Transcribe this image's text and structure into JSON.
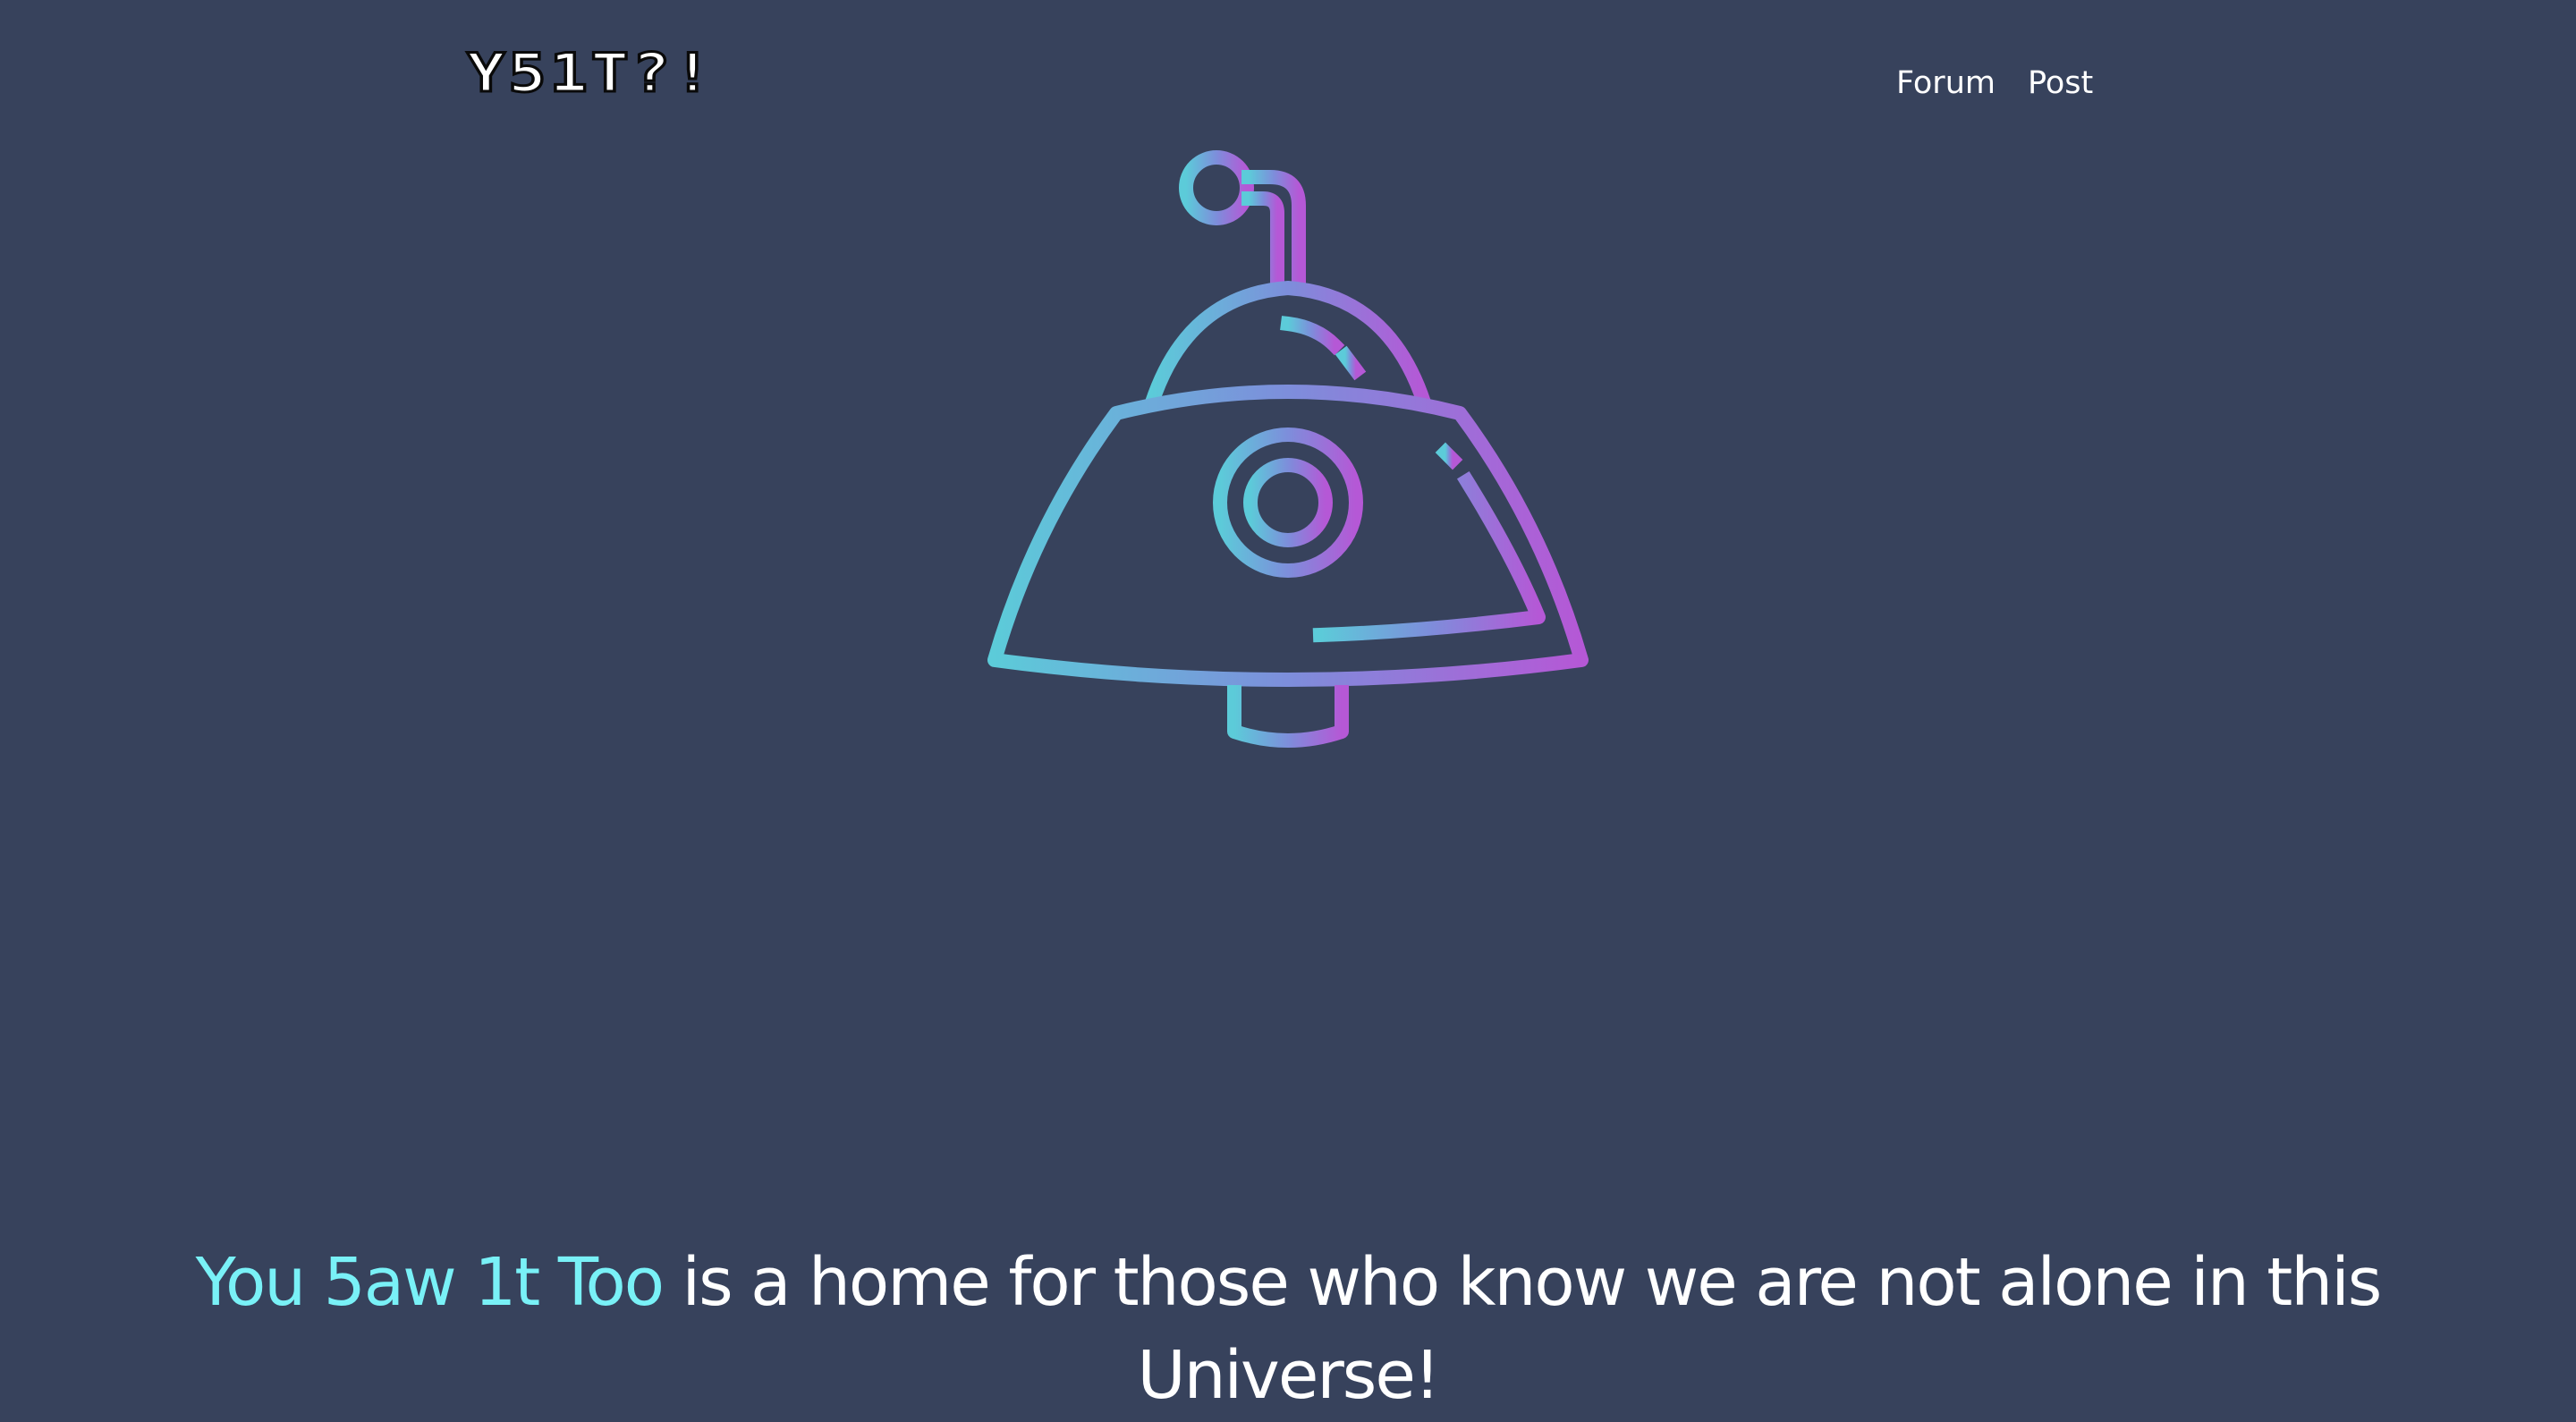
{
  "header": {
    "logo_text": "Y51T?!",
    "nav": [
      {
        "label": "Forum"
      },
      {
        "label": "Post"
      }
    ]
  },
  "hero": {
    "icon": "alien-probe-icon",
    "gradient_start": "#5ccbd9",
    "gradient_mid": "#7d8edb",
    "gradient_end": "#b558d6"
  },
  "tagline": {
    "brand": "You 5aw 1t Too",
    "text": " is a home for those who know we are not alone in this Universe!"
  },
  "colors": {
    "background": "#37425c",
    "brand_accent": "#79f1f7",
    "text": "#ffffff"
  }
}
